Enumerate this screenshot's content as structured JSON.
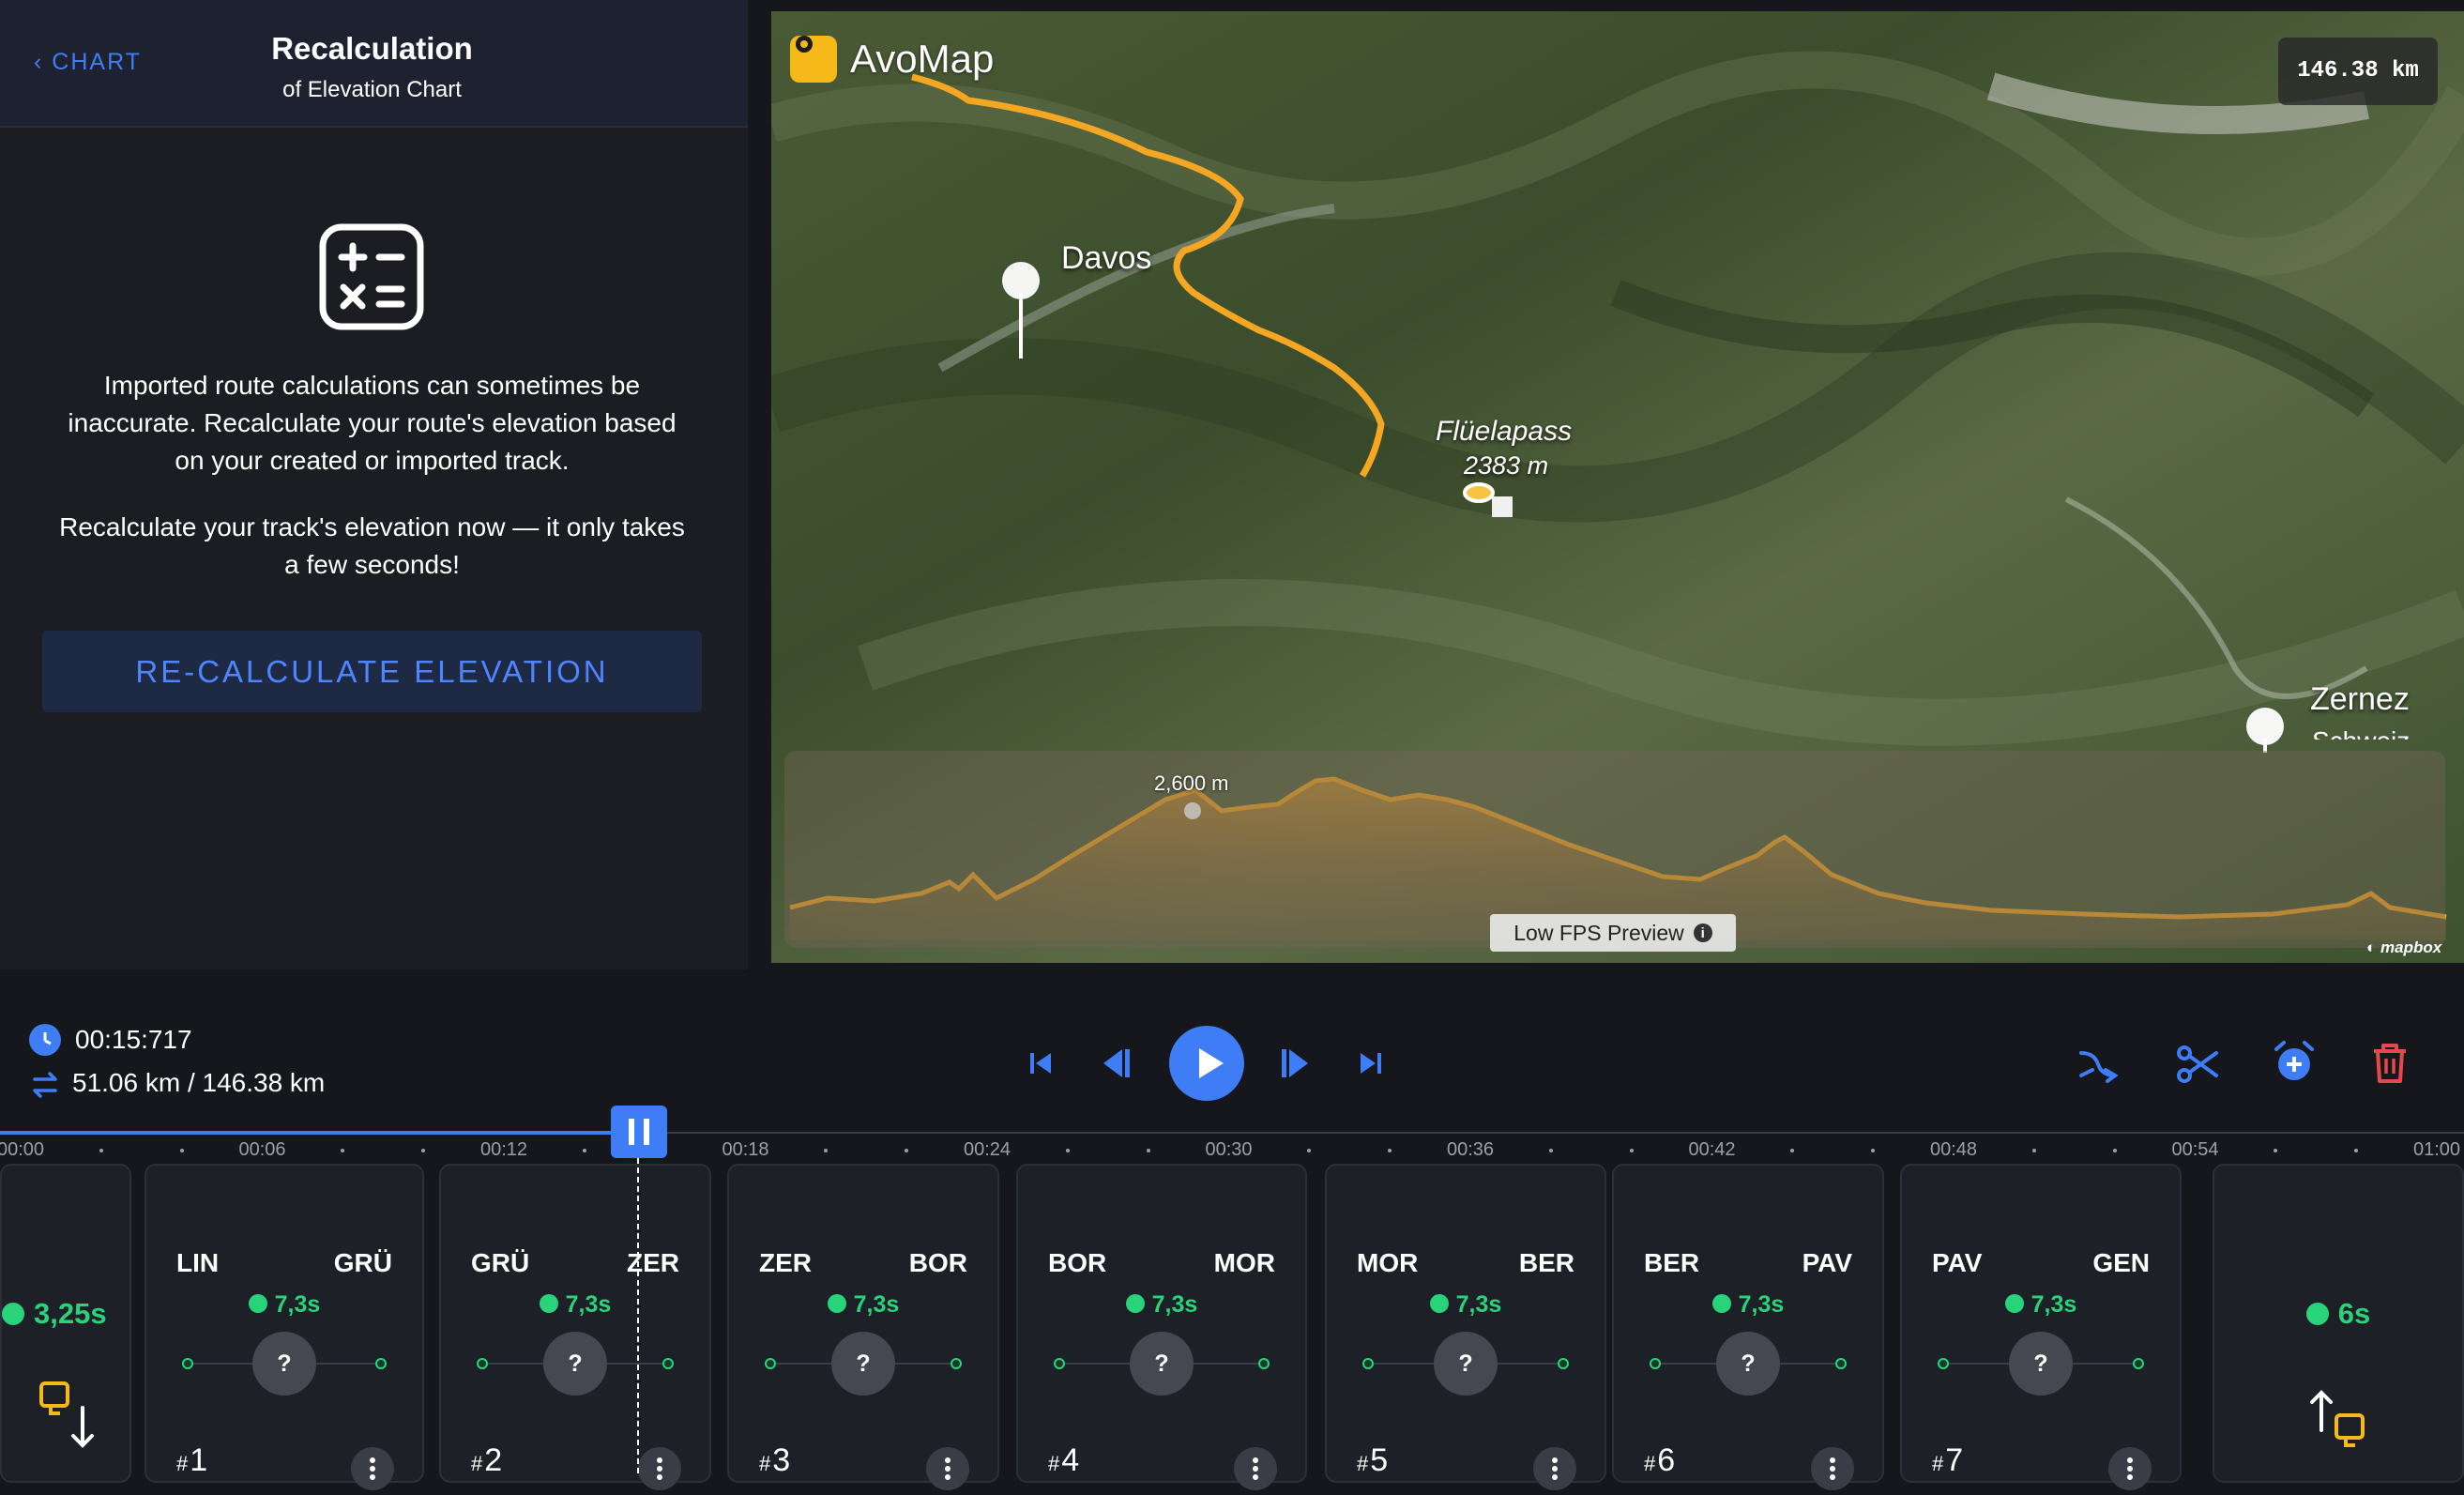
{
  "left_panel": {
    "back_label": "CHART",
    "title": "Recalculation",
    "subtitle": "of Elevation Chart",
    "paragraph1": "Imported route calculations can sometimes be inaccurate. Recalculate your route's elevation based on your created or imported track.",
    "paragraph2": "Recalculate your track's elevation now — it only takes a few seconds!",
    "button_label": "RE-CALCULATE ELEVATION",
    "icon": "calculator-icon"
  },
  "map": {
    "brand": "AvoMap",
    "distance_badge": "146.38 km",
    "places": [
      {
        "name": "Davos"
      },
      {
        "name": "Zernez",
        "sub": "Schweiz"
      }
    ],
    "pass": {
      "name": "Flüelapass",
      "elevation": "2383 m"
    },
    "peak_label": "2,600 m",
    "low_fps_label": "Low FPS Preview",
    "attribution": "mapbox",
    "route_color": "#f5a623"
  },
  "transport": {
    "time": "00:15:717",
    "distance": "51.06 km / 146.38 km",
    "progress": 0.26,
    "controls": [
      "skip-to-start-icon",
      "step-back-icon",
      "play-icon",
      "step-forward-icon",
      "skip-to-end-icon"
    ],
    "tools": [
      "route-icon",
      "scissors-icon",
      "add-alarm-icon",
      "trash-icon"
    ]
  },
  "timeline": {
    "ticks": [
      "00:00",
      "00:06",
      "00:12",
      "00:18",
      "00:24",
      "00:30",
      "00:36",
      "00:42",
      "00:48",
      "00:54",
      "01:00"
    ]
  },
  "segments": {
    "start": {
      "duration": "3,25s"
    },
    "end": {
      "duration": "6s"
    },
    "items": [
      {
        "from": "LIN",
        "to": "GRÜ",
        "duration": "7,3s",
        "transport": "?",
        "number": "1"
      },
      {
        "from": "GRÜ",
        "to": "ZER",
        "duration": "7,3s",
        "transport": "?",
        "number": "2"
      },
      {
        "from": "ZER",
        "to": "BOR",
        "duration": "7,3s",
        "transport": "?",
        "number": "3"
      },
      {
        "from": "BOR",
        "to": "MOR",
        "duration": "7,3s",
        "transport": "?",
        "number": "4"
      },
      {
        "from": "MOR",
        "to": "BER",
        "duration": "7,3s",
        "transport": "?",
        "number": "5"
      },
      {
        "from": "BER",
        "to": "PAV",
        "duration": "7,3s",
        "transport": "?",
        "number": "6"
      },
      {
        "from": "PAV",
        "to": "GEN",
        "duration": "7,3s",
        "transport": "?",
        "number": "7"
      }
    ]
  },
  "colors": {
    "accent": "#3f7df6",
    "green": "#29d37a",
    "danger": "#e5484d",
    "route": "#f5a623"
  }
}
